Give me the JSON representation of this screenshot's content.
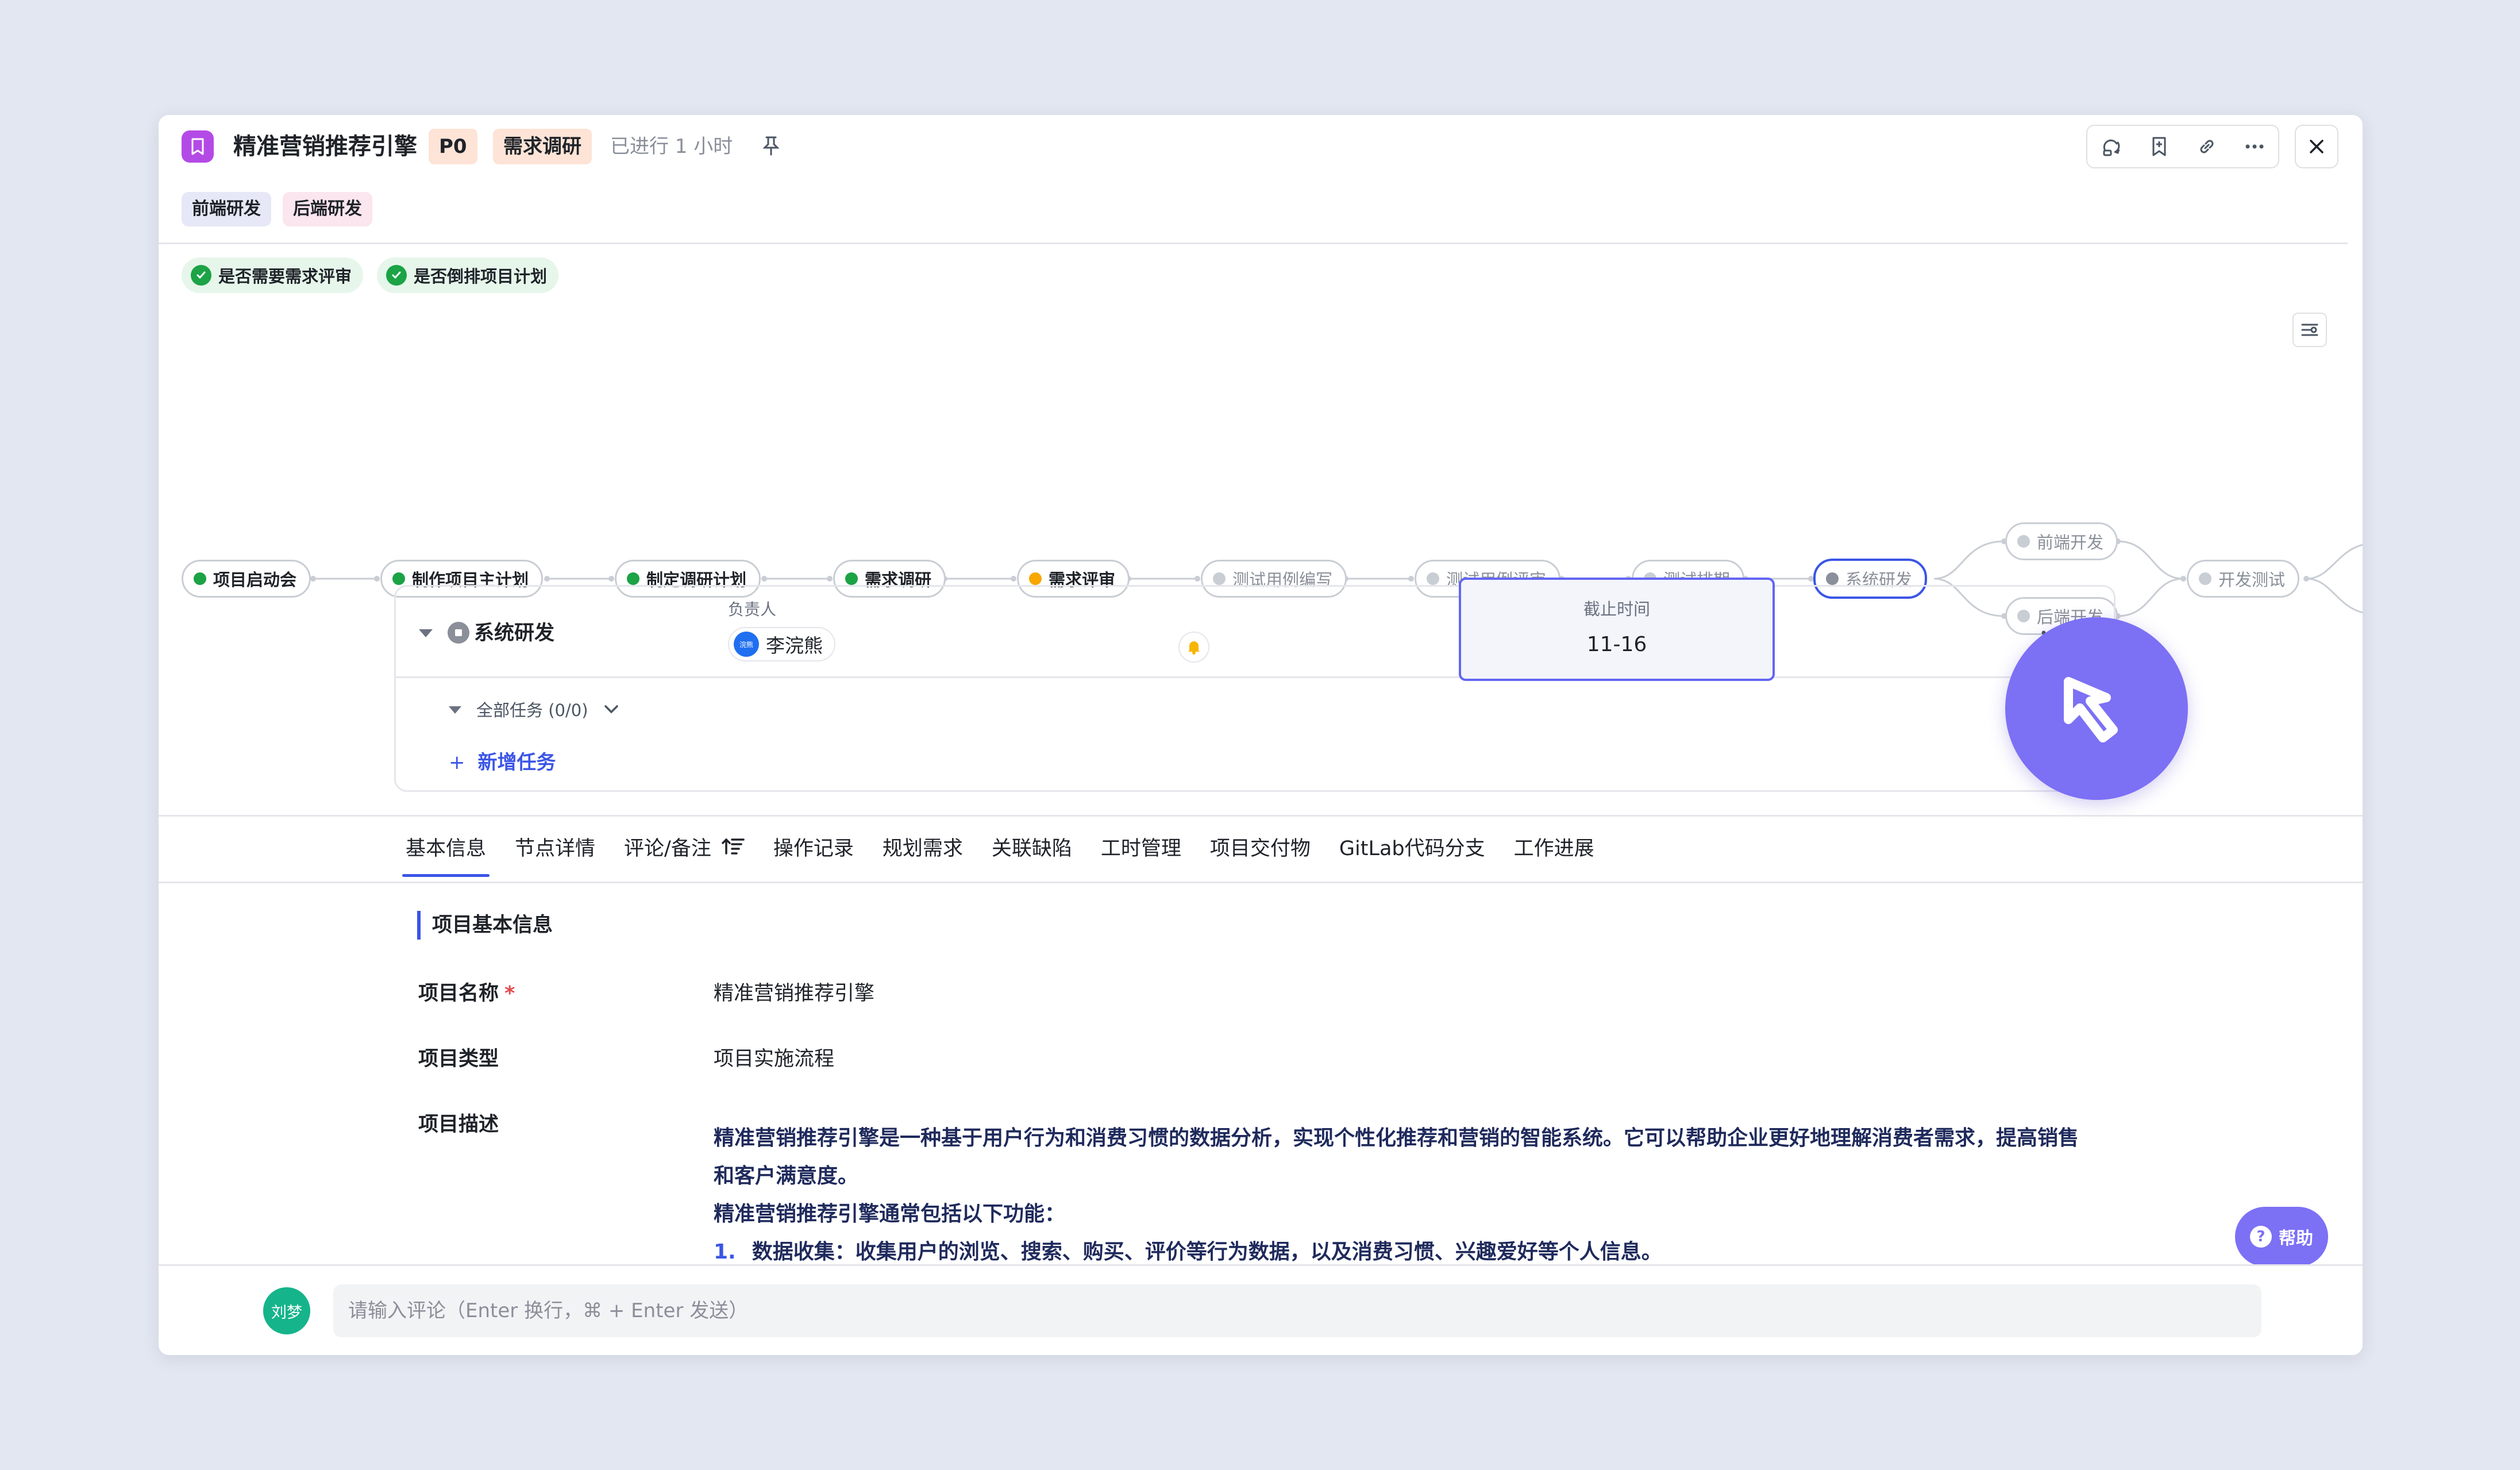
{
  "header": {
    "title": "精准营销推荐引擎",
    "priority": "P0",
    "stage": "需求调研",
    "elapsed": "已进行 1 小时"
  },
  "tags": [
    "前端研发",
    "后端研发"
  ],
  "checks": [
    "是否需要需求评审",
    "是否倒排项目计划"
  ],
  "flow": {
    "nodes": [
      {
        "label": "项目启动会",
        "status": "done"
      },
      {
        "label": "制作项目主计划",
        "status": "done"
      },
      {
        "label": "制定调研计划",
        "status": "done"
      },
      {
        "label": "需求调研",
        "status": "done"
      },
      {
        "label": "需求评审",
        "status": "in-progress"
      },
      {
        "label": "测试用例编写",
        "status": "todo"
      },
      {
        "label": "测试用例评审",
        "status": "todo"
      },
      {
        "label": "测试排期",
        "status": "todo"
      },
      {
        "label": "系统研发",
        "status": "selected"
      },
      {
        "label": "前端开发",
        "status": "todo"
      },
      {
        "label": "后端开发",
        "status": "todo"
      },
      {
        "label": "开发测试",
        "status": "todo"
      }
    ]
  },
  "node_card": {
    "name": "系统研发",
    "owner_label": "负责人",
    "owner_name": "李浣熊",
    "owner_avatar_text": "浣熊",
    "deadline_label": "截止时间",
    "deadline_value": "11-16",
    "all_tasks": "全部任务 (0/0)",
    "add_task": "新增任务"
  },
  "tabs": [
    "基本信息",
    "节点详情",
    "评论/备注",
    "操作记录",
    "规划需求",
    "关联缺陷",
    "工时管理",
    "项目交付物",
    "GitLab代码分支",
    "工作进展"
  ],
  "basic": {
    "section_title": "项目基本信息",
    "name_label": "项目名称",
    "name_required": "*",
    "name_value": "精准营销推荐引擎",
    "type_label": "项目类型",
    "type_value": "项目实施流程",
    "desc_label": "项目描述",
    "desc_p1": "精准营销推荐引擎是一种基于用户行为和消费习惯的数据分析，实现个性化推荐和营销的智能系统。它可以帮助企业更好地理解消费者需求，提高销售和客户满意度。",
    "desc_p2": "精准营销推荐引擎通常包括以下功能：",
    "desc_li1_num": "1.",
    "desc_li1": "数据收集：收集用户的浏览、搜索、购买、评价等行为数据，以及消费习惯、兴趣爱好等个人信息。"
  },
  "help_label": "帮助",
  "comment": {
    "avatar_text": "刘梦",
    "placeholder": "请输入评论（Enter 换行，⌘ + Enter 发送）"
  },
  "colors": {
    "accent": "#3b55e6",
    "done": "#1ba345",
    "in_progress": "#f7a700",
    "cursor": "#7c70f5"
  }
}
